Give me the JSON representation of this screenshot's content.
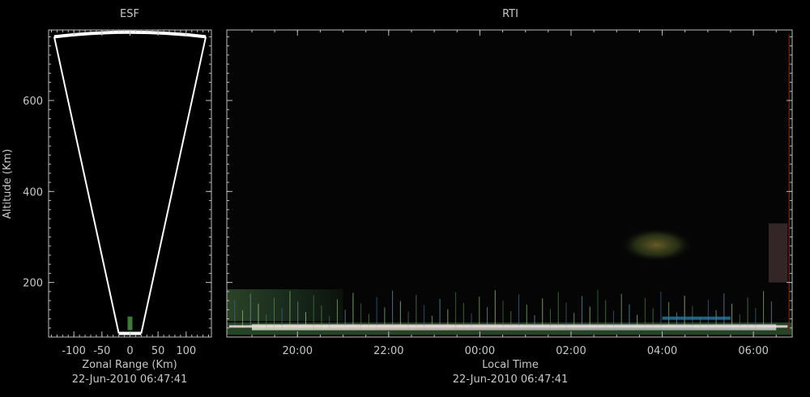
{
  "chart_data": [
    {
      "type": "area",
      "title": "ESF",
      "xlabel": "Zonal Range (Km)",
      "ylabel": "Altitude (Km)",
      "timestamp": "22-Jun-2010 06:47:41",
      "xlim": [
        -145,
        145
      ],
      "ylim": [
        80,
        755
      ],
      "xticks": [
        -100,
        -50,
        0,
        50,
        100
      ],
      "xtick_labels": [
        "-100",
        "-50",
        "0",
        "50",
        "100"
      ],
      "yticks": [
        200,
        400,
        600
      ],
      "ytick_labels": [
        "200",
        "400",
        "600"
      ],
      "grid": false,
      "sector": {
        "apex_altitude": 88,
        "apex_halfwidth": 20,
        "top_altitude": 740,
        "top_halfwidth": 135,
        "arc_peak_altitude": 750
      },
      "echo": {
        "x": 0,
        "y_min": 95,
        "y_max": 125
      }
    },
    {
      "type": "heatmap",
      "title": "RTI",
      "xlabel": "Local Time",
      "timestamp": "22-Jun-2010 06:47:41",
      "xlim_hours": [
        18.45,
        30.85
      ],
      "ylim": [
        80,
        755
      ],
      "xticks": [
        "20:00",
        "22:00",
        "00:00",
        "02:00",
        "04:00",
        "06:00"
      ],
      "yticks": [
        200,
        400,
        600
      ],
      "grid": false,
      "features": [
        {
          "name": "bottom-layer",
          "t_start": "18:27",
          "t_end": "06:50",
          "alt_min": 85,
          "alt_max": 112
        },
        {
          "name": "green-clutter",
          "t_start": "18:27",
          "t_end": "21:00",
          "alt_min": 115,
          "alt_max": 185
        },
        {
          "name": "pinkish-band",
          "t_start": "19:00",
          "t_end": "06:30",
          "alt_min": 95,
          "alt_max": 108
        },
        {
          "name": "plume",
          "t_start": "03:05",
          "t_end": "04:40",
          "alt_min": 245,
          "alt_max": 320
        },
        {
          "name": "irregularity-late",
          "t_start": "06:20",
          "t_end": "06:45",
          "alt_min": 200,
          "alt_max": 330
        }
      ]
    }
  ]
}
